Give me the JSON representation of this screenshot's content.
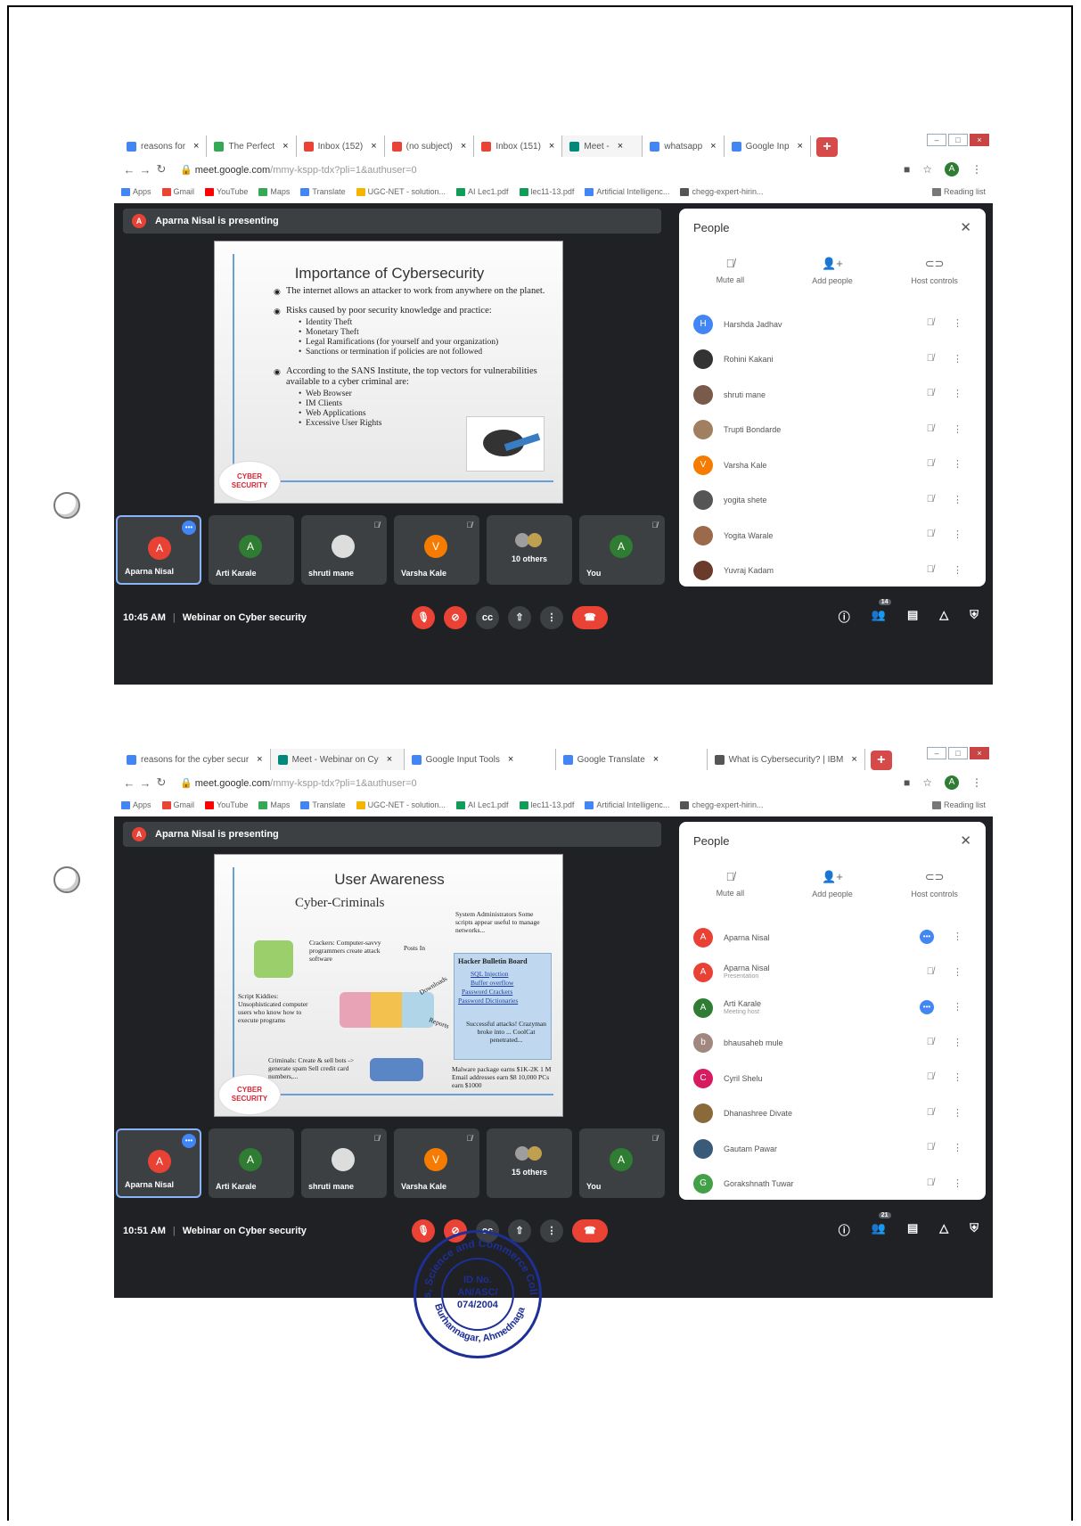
{
  "screenshots": [
    {
      "tabs": [
        {
          "label": "reasons for",
          "color": "#4285f4"
        },
        {
          "label": "The Perfect",
          "color": "#34a853"
        },
        {
          "label": "Inbox (152)",
          "color": "#ea4335"
        },
        {
          "label": "(no subject)",
          "color": "#ea4335"
        },
        {
          "label": "Inbox (151)",
          "color": "#ea4335"
        },
        {
          "label": "Meet -",
          "color": "#00897b"
        },
        {
          "label": "whatsapp",
          "color": "#4285f4"
        },
        {
          "label": "Google Inp",
          "color": "#4285f4"
        }
      ],
      "url_main": "meet.google.com",
      "url_rest": "/mmy-kspp-tdx?pli=1&authuser=0",
      "bookmarks": [
        "Apps",
        "Gmail",
        "YouTube",
        "Maps",
        "Translate",
        "UGC-NET - solution...",
        "AI Lec1.pdf",
        "lec11-13.pdf",
        "Artificial Intelligenc...",
        "chegg-expert-hirin..."
      ],
      "reading_list": "Reading list",
      "presenting": "Aparna Nisal is presenting",
      "slide_title": "Importance of Cybersecurity",
      "bullet1": "The internet allows an attacker to work from anywhere on the planet.",
      "bullet2": "Risks caused by poor security knowledge and practice:",
      "bullet2_items": [
        "Identity Theft",
        "Monetary Theft",
        "Legal Ramifications (for yourself and your organization)",
        "Sanctions or termination if policies are not followed"
      ],
      "bullet3": "According to the SANS Institute, the top vectors for vulnerabilities available to a cyber criminal are:",
      "bullet3_items": [
        "Web Browser",
        "IM Clients",
        "Web Applications",
        "Excessive User Rights"
      ],
      "badge_line1": "CYBER",
      "badge_line2": "SECURITY",
      "thumbs": [
        {
          "initial": "A",
          "name": "Aparna Nisal",
          "color": "#e94235"
        },
        {
          "initial": "A",
          "name": "Arti Karale",
          "color": "#2e7d32"
        },
        {
          "initial": "",
          "name": "shruti mane",
          "color": "#888888"
        },
        {
          "initial": "V",
          "name": "Varsha Kale",
          "color": "#f57c00"
        },
        {
          "initial": "",
          "name": "10 others",
          "color": "#888888"
        },
        {
          "initial": "A",
          "name": "You",
          "color": "#2e7d32"
        }
      ],
      "time": "10:45 AM",
      "meeting_title": "Webinar on Cyber security",
      "people_count": "14",
      "people_title": "People",
      "actions": [
        "Mute all",
        "Add people",
        "Host controls"
      ],
      "people": [
        {
          "initial": "H",
          "name": "Harshda Jadhav",
          "sub": "",
          "color": "#4285f4"
        },
        {
          "initial": "",
          "name": "Rohini Kakani",
          "sub": "",
          "color": "#333333"
        },
        {
          "initial": "",
          "name": "shruti mane",
          "sub": "",
          "color": "#7a5a4a"
        },
        {
          "initial": "",
          "name": "Trupti Bondarde",
          "sub": "",
          "color": "#a08060"
        },
        {
          "initial": "V",
          "name": "Varsha Kale",
          "sub": "",
          "color": "#f57c00"
        },
        {
          "initial": "",
          "name": "yogita shete",
          "sub": "",
          "color": "#555555"
        },
        {
          "initial": "",
          "name": "Yogita Warale",
          "sub": "",
          "color": "#9a6a4a"
        },
        {
          "initial": "",
          "name": "Yuvraj Kadam",
          "sub": "",
          "color": "#6a3a2a"
        }
      ]
    },
    {
      "tabs": [
        {
          "label": "reasons for the cyber secur",
          "color": "#4285f4"
        },
        {
          "label": "Meet - Webinar on Cy",
          "color": "#00897b"
        },
        {
          "label": "Google Input Tools",
          "color": "#4285f4"
        },
        {
          "label": "Google Translate",
          "color": "#4285f4"
        },
        {
          "label": "What is Cybersecurity? | IBM",
          "color": "#555555"
        }
      ],
      "url_main": "meet.google.com",
      "url_rest": "/mmy-kspp-tdx?pli=1&authuser=0",
      "bookmarks": [
        "Apps",
        "Gmail",
        "YouTube",
        "Maps",
        "Translate",
        "UGC-NET - solution...",
        "AI Lec1.pdf",
        "lec11-13.pdf",
        "Artificial Intelligenc...",
        "chegg-expert-hirin..."
      ],
      "reading_list": "Reading list",
      "presenting": "Aparna Nisal is presenting",
      "slide_title": "User Awareness",
      "slide_sub": "Cyber-Criminals",
      "s2_cracker": "Crackers: Computer-savvy programmers create attack software",
      "s2_script": "Script Kiddies: Unsophisticated computer users who know how to execute programs",
      "s2_criminals": "Criminals: Create & sell bots -> generate spam Sell credit card numbers,...",
      "s2_sysadmin": "System Administrators Some scripts appear useful to manage networks...",
      "s2_board_title": "Hacker Bulletin Board",
      "s2_board_items": [
        "SQL Injection",
        "Buffer overflow",
        "Password Crackers",
        "Password Dictionaries"
      ],
      "s2_success": "Successful attacks! Crazyman broke into ... CoolCat penetrated...",
      "s2_malware": "Malware package earns $1K-2K 1 M Email addresses earn $8 10,000 PCs earn $1000",
      "s2_posts": "Posts In",
      "s2_downloads": "Downloads",
      "s2_reports": "Reports",
      "badge_line1": "CYBER",
      "badge_line2": "SECURITY",
      "thumbs": [
        {
          "initial": "A",
          "name": "Aparna Nisal",
          "color": "#e94235"
        },
        {
          "initial": "A",
          "name": "Arti Karale",
          "color": "#2e7d32"
        },
        {
          "initial": "",
          "name": "shruti mane",
          "color": "#888888"
        },
        {
          "initial": "V",
          "name": "Varsha Kale",
          "color": "#f57c00"
        },
        {
          "initial": "",
          "name": "15 others",
          "color": "#888888"
        },
        {
          "initial": "A",
          "name": "You",
          "color": "#2e7d32"
        }
      ],
      "time": "10:51 AM",
      "meeting_title": "Webinar on Cyber security",
      "people_count": "21",
      "people_title": "People",
      "actions": [
        "Mute all",
        "Add people",
        "Host controls"
      ],
      "people": [
        {
          "initial": "A",
          "name": "Aparna Nisal",
          "sub": "",
          "color": "#e94235"
        },
        {
          "initial": "A",
          "name": "Aparna Nisal",
          "sub": "Presentation",
          "color": "#e94235"
        },
        {
          "initial": "A",
          "name": "Arti Karale",
          "sub": "Meeting host",
          "color": "#2e7d32"
        },
        {
          "initial": "b",
          "name": "bhausaheb mule",
          "sub": "",
          "color": "#a1887f"
        },
        {
          "initial": "C",
          "name": "Cyril Shelu",
          "sub": "",
          "color": "#d81b60"
        },
        {
          "initial": "",
          "name": "Dhanashree Divate",
          "sub": "",
          "color": "#8a6a3a"
        },
        {
          "initial": "",
          "name": "Gautam Pawar",
          "sub": "",
          "color": "#3a5a7a"
        },
        {
          "initial": "G",
          "name": "Gorakshnath Tuwar",
          "sub": "",
          "color": "#43a047"
        }
      ]
    }
  ],
  "stamp": {
    "ring_text": "Arts, Science and Commerce College",
    "bottom_text": "Burhannagar, Ahmednagar",
    "id_line1": "ID No.",
    "id_line2": "AN/ASC/",
    "id_line3": "074/2004",
    "color": "#1e2f95"
  }
}
